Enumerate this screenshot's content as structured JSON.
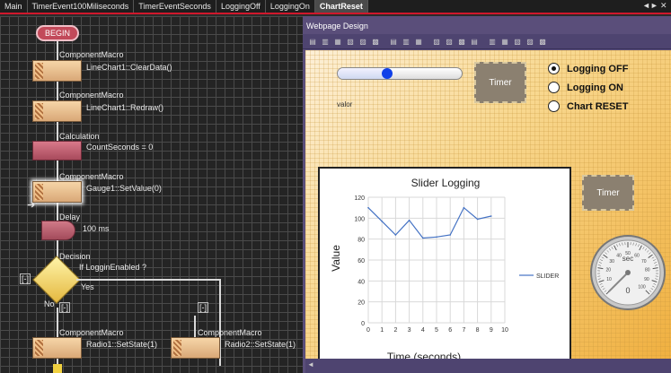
{
  "tabs": [
    "Main",
    "TimerEvent100Miliseconds",
    "TimerEventSeconds",
    "LoggingOff",
    "LoggingOn",
    "ChartReset"
  ],
  "active_tab": "ChartReset",
  "tab_controls": {
    "nav": "◄►",
    "close": "✕"
  },
  "flowchart": {
    "begin": "BEGIN",
    "blocks": [
      {
        "type": "ComponentMacro",
        "text": "LineChart1::ClearData()"
      },
      {
        "type": "ComponentMacro",
        "text": "LineChart1::Redraw()"
      },
      {
        "type": "Calculation",
        "text": "CountSeconds = 0"
      },
      {
        "type": "ComponentMacro",
        "text": "Gauge1::SetValue(0)"
      },
      {
        "type": "Delay",
        "text": "100 ms"
      },
      {
        "type": "Decision",
        "text": "If LogginEnabled ?"
      }
    ],
    "decision_yes": "Yes",
    "decision_no": "No",
    "collapse_marker": "[-]",
    "branch_left": {
      "type": "ComponentMacro",
      "text": "Radio1::SetState(1)"
    },
    "branch_right": {
      "type": "ComponentMacro",
      "text": "Radio2::SetState(1)"
    }
  },
  "design": {
    "title": "Webpage Design",
    "slider_label": "valor",
    "slider_value": 0.4,
    "timer_label": "Timer",
    "radios": [
      {
        "label": "Logging OFF",
        "selected": true
      },
      {
        "label": "Logging ON",
        "selected": false
      },
      {
        "label": "Chart RESET",
        "selected": false
      }
    ],
    "gauge": {
      "unit": "sec",
      "value": 0,
      "display": "0",
      "tick_labels": [
        "10",
        "20",
        "30",
        "40",
        "50",
        "60",
        "70",
        "80",
        "90",
        "100"
      ]
    }
  },
  "chart_data": {
    "type": "line",
    "title": "Slider Logging",
    "xlabel": "Time (seconds)",
    "ylabel": "Value",
    "xlim": [
      0,
      10
    ],
    "ylim": [
      0,
      120
    ],
    "xticks": [
      0,
      1,
      2,
      3,
      4,
      5,
      6,
      7,
      8,
      9,
      10
    ],
    "yticks": [
      0,
      20,
      40,
      60,
      80,
      100,
      120
    ],
    "grid": true,
    "legend": "right",
    "series": [
      {
        "name": "SLIDER",
        "color": "#4472c4",
        "x": [
          0,
          1,
          2,
          3,
          4,
          5,
          6,
          7,
          8,
          9
        ],
        "y": [
          110,
          97,
          84,
          98,
          81,
          82,
          84,
          110,
          99,
          102
        ]
      }
    ]
  },
  "colors": {
    "tab_accent": "#d0182c",
    "panel_purple": "#5a4e7a",
    "slider_thumb": "#1040e8",
    "series": "#4472c4"
  }
}
